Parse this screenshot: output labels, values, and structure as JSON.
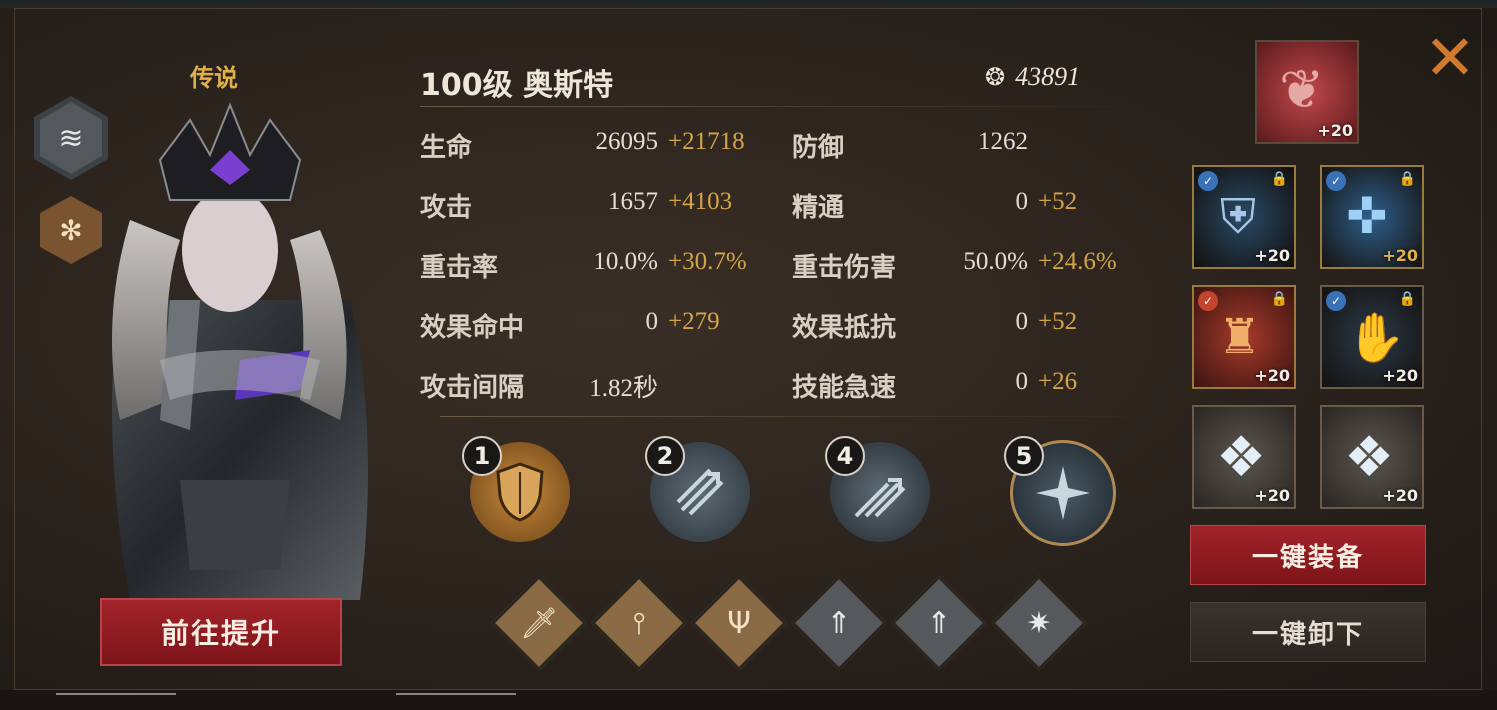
{
  "hero": {
    "rarity": "传说",
    "level_name": "100级 奥斯特",
    "power": "43891",
    "class_icon": "wind-icon",
    "element_icon": "snowflake-icon",
    "upgrade_button": "前往提升"
  },
  "stats": {
    "left": [
      {
        "label": "生命",
        "base": "26095",
        "bonus": "+21718"
      },
      {
        "label": "攻击",
        "base": "1657",
        "bonus": "+4103"
      },
      {
        "label": "重击率",
        "base": "10.0%",
        "bonus": "+30.7%"
      },
      {
        "label": "效果命中",
        "base": "0",
        "bonus": "+279"
      },
      {
        "label": "攻击间隔",
        "base": "1.82秒",
        "bonus": ""
      }
    ],
    "right": [
      {
        "label": "防御",
        "base": "1262",
        "bonus": ""
      },
      {
        "label": "精通",
        "base": "0",
        "bonus": "+52"
      },
      {
        "label": "重击伤害",
        "base": "50.0%",
        "bonus": "+24.6%"
      },
      {
        "label": "效果抵抗",
        "base": "0",
        "bonus": "+52"
      },
      {
        "label": "技能急速",
        "base": "0",
        "bonus": "+26"
      }
    ]
  },
  "skills": [
    {
      "num": "1",
      "icon": "shield-icon"
    },
    {
      "num": "2",
      "icon": "arrows-icon"
    },
    {
      "num": "4",
      "icon": "arrow-volley-icon"
    },
    {
      "num": "5",
      "icon": "ultimate-icon"
    }
  ],
  "runes": [
    "sword-icon",
    "sword-ground-icon",
    "tridents-icon",
    "up-arrow-ripple-icon",
    "up-arrow-ripple-icon",
    "spikes-icon"
  ],
  "equipment": {
    "top": {
      "plus": "+20",
      "icon": "red-amulet-icon"
    },
    "slots": [
      {
        "plus": "+20",
        "icon": "dark-helmet-icon"
      },
      {
        "plus": "+20",
        "icon": "blue-crossbow-icon"
      },
      {
        "plus": "+20",
        "icon": "red-armor-icon"
      },
      {
        "plus": "+20",
        "icon": "blue-gauntlet-icon"
      },
      {
        "plus": "+20",
        "icon": "crystal-icon"
      },
      {
        "plus": "+20",
        "icon": "crystal-icon"
      }
    ],
    "equip_all": "一键装备",
    "unequip_all": "一键卸下"
  },
  "colors": {
    "accent_gold": "#d4a548",
    "button_red": "#9a1e24",
    "rarity_gold": "#e0b04a"
  }
}
